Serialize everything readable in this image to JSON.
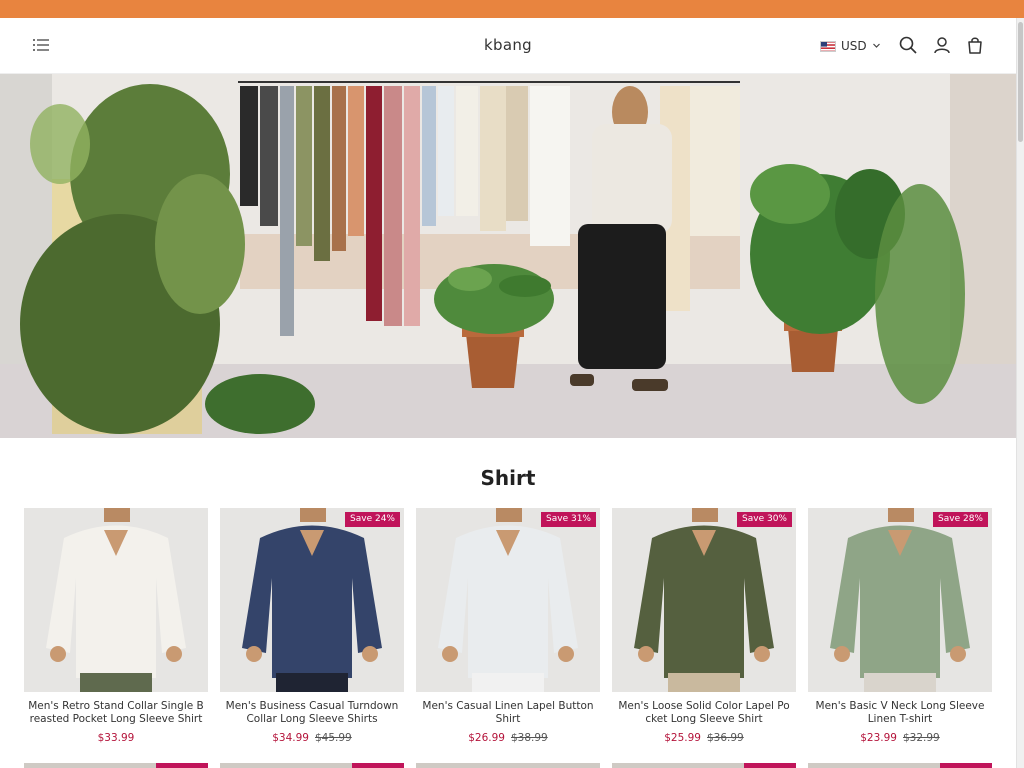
{
  "header": {
    "brand": "kbang",
    "currency": "USD",
    "icons": [
      "menu-icon",
      "search-icon",
      "account-icon",
      "cart-icon"
    ]
  },
  "colors": {
    "announcement_bar": "#e8843f",
    "sale_badge": "#c0145a",
    "sale_price": "#b4133a"
  },
  "section": {
    "title": "Shirt"
  },
  "products": [
    {
      "name": "Men's Retro Stand Collar Single Breasted Pocket Long Sleeve Shirt",
      "price": "$33.99",
      "compare_price": "",
      "badge": "",
      "shirt_color": "#f3f1ec",
      "pants_color": "#5f6a4e"
    },
    {
      "name": "Men's Business Casual Turndown Collar Long Sleeve Shirts",
      "price": "$34.99",
      "compare_price": "$45.99",
      "badge": "Save 24%",
      "shirt_color": "#34446a",
      "pants_color": "#1f2433"
    },
    {
      "name": "Men's Casual Linen Lapel Button Shirt",
      "price": "$26.99",
      "compare_price": "$38.99",
      "badge": "Save 31%",
      "shirt_color": "#e9ecee",
      "pants_color": "#f1f1f1"
    },
    {
      "name": "Men's Loose Solid Color Lapel Pocket Long Sleeve Shirt",
      "price": "$25.99",
      "compare_price": "$36.99",
      "badge": "Save 30%",
      "shirt_color": "#55603f",
      "pants_color": "#c9b99e"
    },
    {
      "name": "Men's Basic V Neck Long Sleeve Linen T-shirt",
      "price": "$23.99",
      "compare_price": "$32.99",
      "badge": "Save 28%",
      "shirt_color": "#8fa587",
      "pants_color": "#d9d4cc"
    }
  ]
}
